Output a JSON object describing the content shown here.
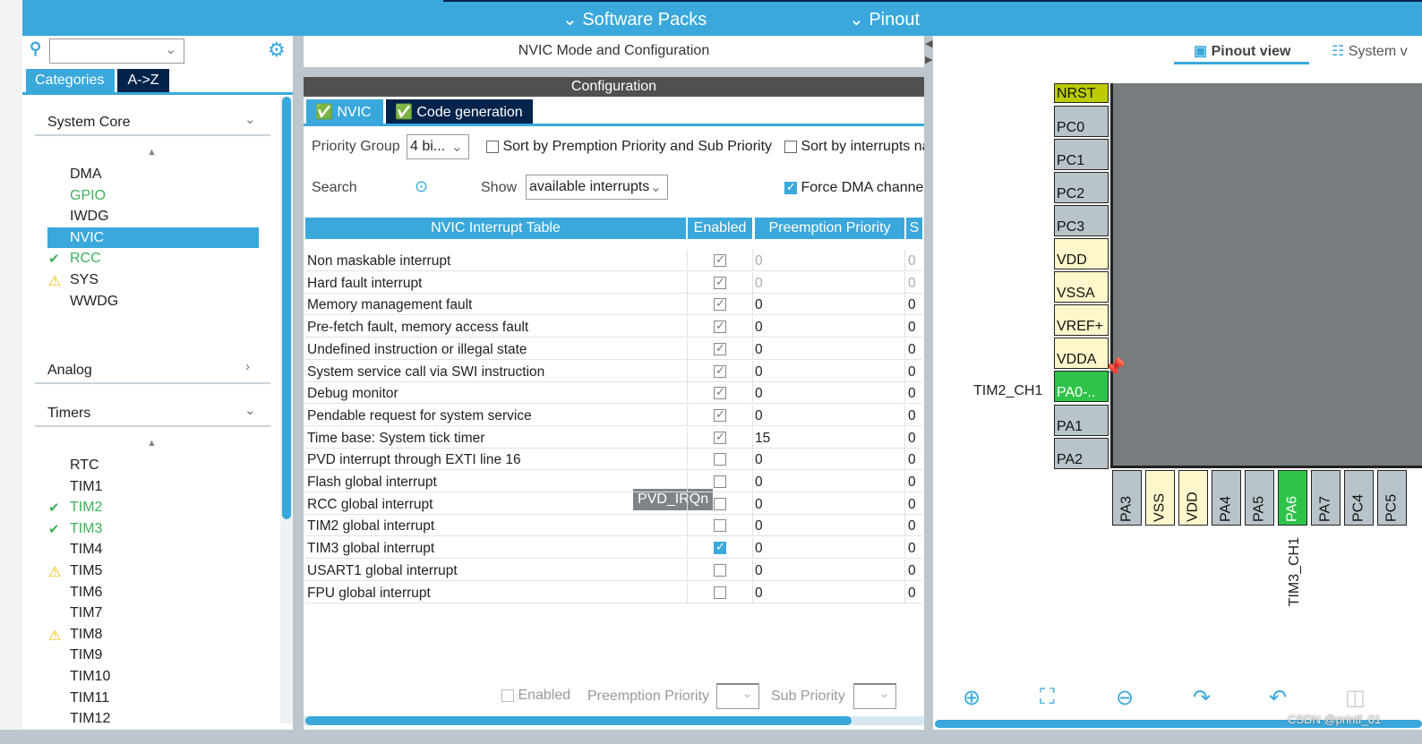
{
  "topbar": {
    "menus": [
      "Software Packs",
      "Pinout"
    ]
  },
  "left": {
    "tabs": [
      "Categories",
      "A->Z"
    ],
    "categories": [
      {
        "label": "System Core",
        "expanded": true
      },
      {
        "label": "Analog",
        "expanded": false
      },
      {
        "label": "Timers",
        "expanded": true
      }
    ],
    "system_core": [
      {
        "label": "DMA",
        "status": ""
      },
      {
        "label": "GPIO",
        "status": "configured"
      },
      {
        "label": "IWDG",
        "status": ""
      },
      {
        "label": "NVIC",
        "status": "selected"
      },
      {
        "label": "RCC",
        "status": "ok"
      },
      {
        "label": "SYS",
        "status": "warning"
      },
      {
        "label": "WWDG",
        "status": ""
      }
    ],
    "timers": [
      {
        "label": "RTC",
        "status": ""
      },
      {
        "label": "TIM1",
        "status": ""
      },
      {
        "label": "TIM2",
        "status": "ok"
      },
      {
        "label": "TIM3",
        "status": "ok"
      },
      {
        "label": "TIM4",
        "status": ""
      },
      {
        "label": "TIM5",
        "status": "warning"
      },
      {
        "label": "TIM6",
        "status": ""
      },
      {
        "label": "TIM7",
        "status": ""
      },
      {
        "label": "TIM8",
        "status": "warning"
      },
      {
        "label": "TIM9",
        "status": ""
      },
      {
        "label": "TIM10",
        "status": ""
      },
      {
        "label": "TIM11",
        "status": ""
      },
      {
        "label": "TIM12",
        "status": ""
      }
    ]
  },
  "mid": {
    "title": "NVIC Mode and Configuration",
    "config": "Configuration",
    "tabs": [
      "NVIC",
      "Code generation"
    ],
    "priority_group_label": "Priority Group",
    "priority_group_value": "4 bi...",
    "sort1": "Sort by Premption Priority and Sub Priority",
    "sort2": "Sort by interrupts na",
    "search_label": "Search",
    "show_label": "Show",
    "show_value": "available interrupts",
    "force_dma": "Force DMA channe",
    "columns": [
      "NVIC Interrupt Table",
      "Enabled",
      "Preemption Priority",
      "S"
    ],
    "rows": [
      {
        "name": "Non maskable interrupt",
        "enabled": true,
        "locked": true,
        "pre": "0",
        "sub": "0"
      },
      {
        "name": "Hard fault interrupt",
        "enabled": true,
        "locked": true,
        "pre": "0",
        "sub": "0"
      },
      {
        "name": "Memory management fault",
        "enabled": true,
        "locked": false,
        "pre": "0",
        "sub": "0"
      },
      {
        "name": "Pre-fetch fault, memory access fault",
        "enabled": true,
        "locked": false,
        "pre": "0",
        "sub": "0"
      },
      {
        "name": "Undefined instruction or illegal state",
        "enabled": true,
        "locked": false,
        "pre": "0",
        "sub": "0"
      },
      {
        "name": "System service call via SWI instruction",
        "enabled": true,
        "locked": false,
        "pre": "0",
        "sub": "0"
      },
      {
        "name": "Debug monitor",
        "enabled": true,
        "locked": false,
        "pre": "0",
        "sub": "0"
      },
      {
        "name": "Pendable request for system service",
        "enabled": true,
        "locked": false,
        "pre": "0",
        "sub": "0"
      },
      {
        "name": "Time base: System tick timer",
        "enabled": true,
        "locked": false,
        "pre": "15",
        "sub": "0"
      },
      {
        "name": "PVD interrupt through EXTI line 16",
        "enabled": false,
        "locked": false,
        "pre": "0",
        "sub": "0"
      },
      {
        "name": "Flash global interrupt",
        "enabled": false,
        "locked": false,
        "pre": "0",
        "sub": "0"
      },
      {
        "name": "RCC global interrupt",
        "enabled": false,
        "locked": false,
        "pre": "0",
        "sub": "0"
      },
      {
        "name": "TIM2 global interrupt",
        "enabled": false,
        "locked": false,
        "pre": "0",
        "sub": "0"
      },
      {
        "name": "TIM3 global interrupt",
        "enabled": true,
        "user": true,
        "locked": false,
        "pre": "0",
        "sub": "0"
      },
      {
        "name": "USART1 global interrupt",
        "enabled": false,
        "locked": false,
        "pre": "0",
        "sub": "0"
      },
      {
        "name": "FPU global interrupt",
        "enabled": false,
        "locked": false,
        "pre": "0",
        "sub": "0"
      }
    ],
    "tooltip": "PVD_IRQn",
    "footer": {
      "enabled": "Enabled",
      "pre": "Preemption Priority",
      "sub": "Sub Priority"
    }
  },
  "right": {
    "tabs": [
      "Pinout view",
      "System v"
    ],
    "left_pins": [
      {
        "n": "NRST",
        "c": "ol"
      },
      {
        "n": "PC0",
        "c": "g"
      },
      {
        "n": "PC1",
        "c": "g"
      },
      {
        "n": "PC2",
        "c": "g"
      },
      {
        "n": "PC3",
        "c": "g"
      },
      {
        "n": "VDD",
        "c": "y"
      },
      {
        "n": "VSSA",
        "c": "y"
      },
      {
        "n": "VREF+",
        "c": "y"
      },
      {
        "n": "VDDA",
        "c": "y"
      },
      {
        "n": "PA0-..",
        "c": "gr"
      },
      {
        "n": "PA1",
        "c": "g"
      },
      {
        "n": "PA2",
        "c": "g"
      }
    ],
    "bottom_pins": [
      {
        "n": "PA3",
        "c": "g"
      },
      {
        "n": "VSS",
        "c": "y"
      },
      {
        "n": "VDD",
        "c": "y"
      },
      {
        "n": "PA4",
        "c": "g"
      },
      {
        "n": "PA5",
        "c": "g"
      },
      {
        "n": "PA6",
        "c": "gr"
      },
      {
        "n": "PA7",
        "c": "g"
      },
      {
        "n": "PC4",
        "c": "g"
      },
      {
        "n": "PC5",
        "c": "g"
      }
    ],
    "label_pa0": "TIM2_CH1",
    "label_pa6": "TIM3_CH1",
    "watermark": "CSDN @printf_01"
  }
}
